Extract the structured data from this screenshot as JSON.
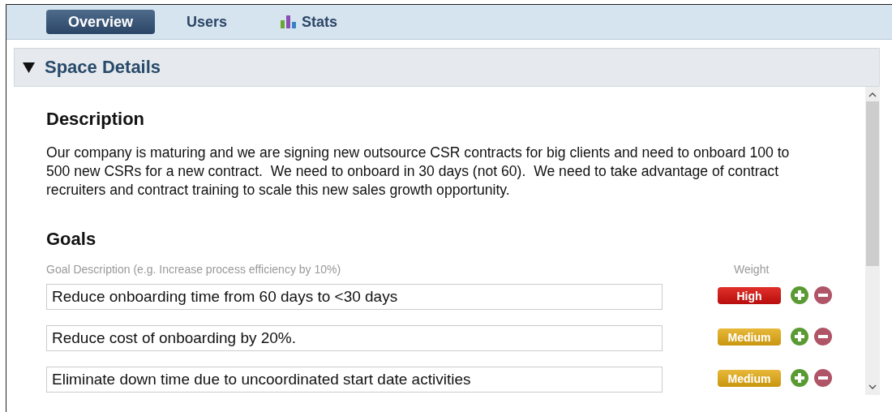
{
  "tabs": [
    {
      "label": "Overview",
      "selected": true,
      "kind": "text"
    },
    {
      "label": "Users",
      "selected": false,
      "kind": "text"
    },
    {
      "label": "Stats",
      "selected": false,
      "kind": "chart"
    }
  ],
  "section": {
    "title": "Space Details",
    "expanded": true
  },
  "description": {
    "heading": "Description",
    "text": "Our company is maturing and we are signing new outsource CSR contracts for big clients and need to onboard 100 to 500 new CSRs for a new contract.  We need to onboard in 30 days (not 60).  We need to take advantage of contract recruiters and contract training to scale this new sales growth opportunity."
  },
  "goals": {
    "heading": "Goals",
    "description_header": "Goal Description (e.g. Increase process efficiency by 10%)",
    "weight_header": "Weight",
    "rows": [
      {
        "value": "Reduce onboarding time from 60 days to <30 days",
        "weight": "High",
        "kind": "high"
      },
      {
        "value": "Reduce cost of onboarding by 20%.",
        "weight": "Medium",
        "kind": "medium"
      },
      {
        "value": "Eliminate down time due to uncoordinated start date activities",
        "weight": "Medium",
        "kind": "medium"
      }
    ]
  }
}
